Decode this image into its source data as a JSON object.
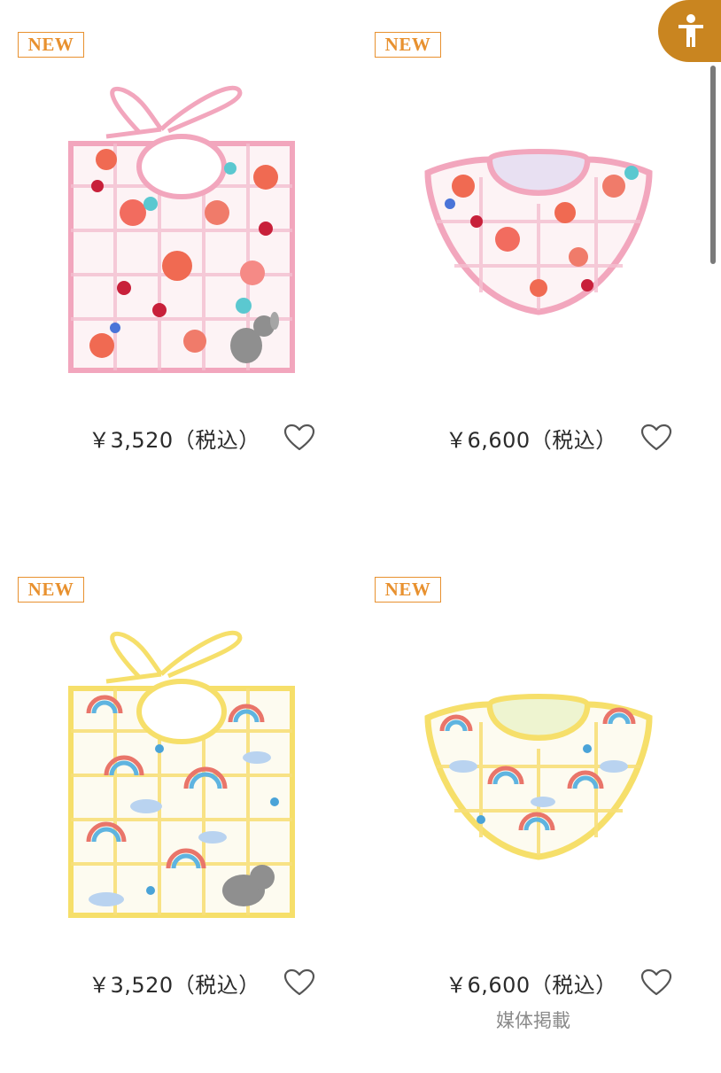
{
  "products": [
    {
      "badge": "NEW",
      "price": "￥3,520（税込）",
      "image": "square-bib-pink-floral",
      "accent": "#f2a6bd",
      "favorite_icon": "heart-outline-icon"
    },
    {
      "badge": "NEW",
      "price": "￥6,600（税込）",
      "image": "round-bib-pink-floral",
      "accent": "#f2a6bd",
      "favorite_icon": "heart-outline-icon"
    },
    {
      "badge": "NEW",
      "price": "￥3,520（税込）",
      "image": "square-bib-yellow-rainbow",
      "accent": "#f6df6a",
      "favorite_icon": "heart-outline-icon"
    },
    {
      "badge": "NEW",
      "price": "￥6,600（税込）",
      "image": "round-bib-yellow-rainbow",
      "accent": "#f6df6a",
      "favorite_icon": "heart-outline-icon"
    }
  ],
  "media_link": "媒体掲載",
  "accessibility_button": {
    "icon": "accessibility-person-icon",
    "color": "#c98520"
  },
  "colors": {
    "badge": "#e8912f",
    "text": "#2b2b2b",
    "muted": "#8a8a8a"
  }
}
